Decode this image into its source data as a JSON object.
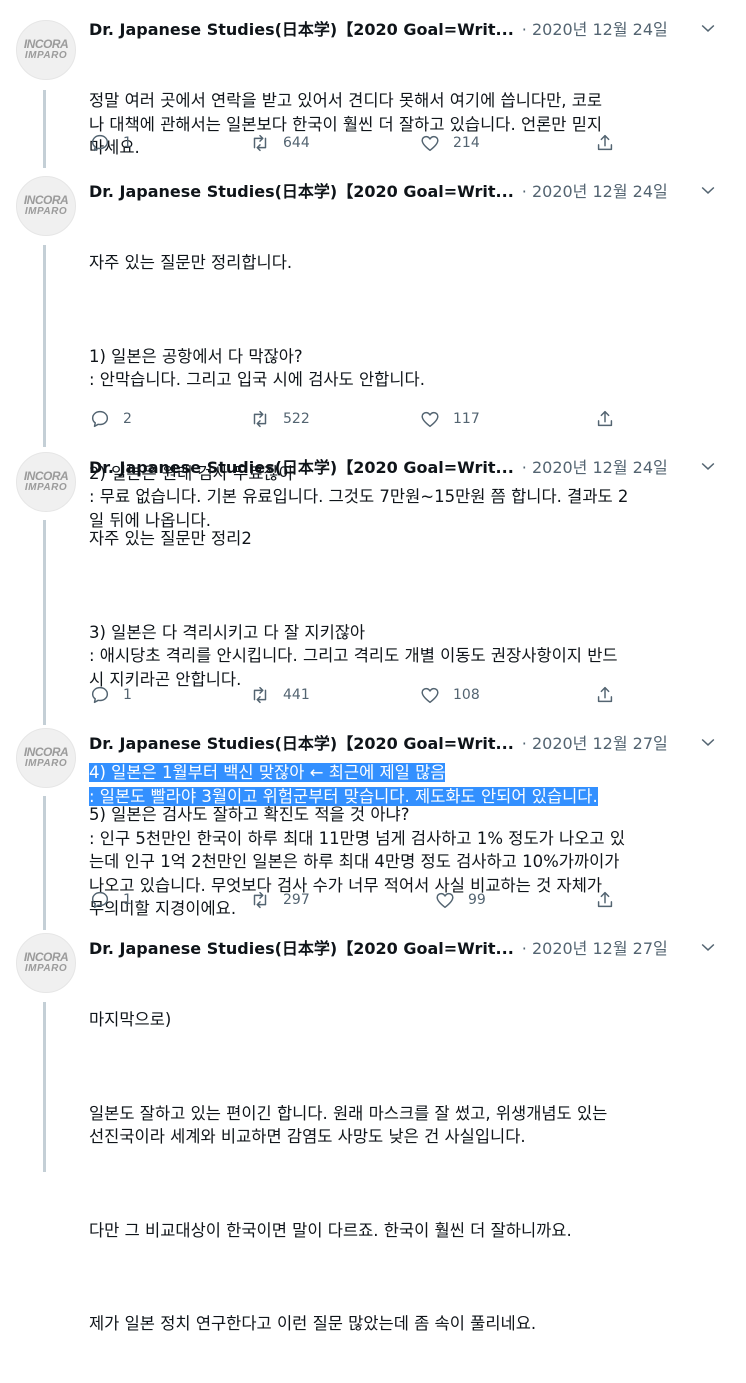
{
  "tweets": [
    {
      "avatar": {
        "line1": "INCORA",
        "line2": "IMPARO"
      },
      "author": "Dr. Japanese Studies(日本学)【2020 Goal=Writ...",
      "date": "· 2020년 12월 24일",
      "paragraphs": [
        "정말 여러 곳에서 연락을 받고 있어서 견디다 못해서 여기에 씁니다만, 코로\n나 대책에 관해서는 일본보다 한국이 훨씬 더 잘하고 있습니다. 언론만 믿지\n마세요."
      ],
      "replies": "1",
      "retweets": "644",
      "likes": "214"
    },
    {
      "avatar": {
        "line1": "INCORA",
        "line2": "IMPARO"
      },
      "author": "Dr. Japanese Studies(日本学)【2020 Goal=Writ...",
      "date": "· 2020년 12월 24일",
      "paragraphs": [
        "자주 있는 질문만 정리합니다.",
        "1) 일본은 공항에서 다 막잖아?\n: 안막습니다. 그리고 입국 시에 검사도 안합니다.",
        "2) 일본은 원래 검사 무료잖아\n: 무료 없습니다. 기본 유료입니다. 그것도 7만원~15만원 쯤 합니다. 결과도 2\n일 뒤에 나옵니다."
      ],
      "replies": "2",
      "retweets": "522",
      "likes": "117"
    },
    {
      "avatar": {
        "line1": "INCORA",
        "line2": "IMPARO"
      },
      "author": "Dr. Japanese Studies(日本学)【2020 Goal=Writ...",
      "date": "· 2020년 12월 24일",
      "paragraphs": [
        "자주 있는 질문만 정리2",
        "3) 일본은 다 격리시키고 다 잘 지키잖아\n: 애시당초 격리를 안시킵니다. 그리고 격리도 개별 이동도 권장사항이지 반드\n시 지키라곤 안합니다."
      ],
      "highlight_lines": [
        "4) 일본은 1월부터 백신 맞잖아 ← 최근에 제일 많음",
        ": 일본도 빨라야 3월이고 위험군부터 맞습니다. 제도화도 안되어 있습니다."
      ],
      "replies": "1",
      "retweets": "441",
      "likes": "108"
    },
    {
      "avatar": {
        "line1": "INCORA",
        "line2": "IMPARO"
      },
      "author": "Dr. Japanese Studies(日本学)【2020 Goal=Writ...",
      "date": "· 2020년 12월 27일",
      "paragraphs": [
        "5) 일본은 검사도 잘하고 확진도 적을 것 아냐?\n: 인구 5천만인 한국이 하루 최대 11만명 넘게 검사하고 1% 정도가 나오고 있\n는데 인구 1억 2천만인 일본은 하루 최대 4만명 정도 검사하고 10%가까이가\n나오고 있습니다. 무엇보다 검사 수가 너무 적어서 사실 비교하는 것 자체가\n무의미할 지경이에요."
      ],
      "replies": "1",
      "retweets": "297",
      "likes": "99"
    },
    {
      "avatar": {
        "line1": "INCORA",
        "line2": "IMPARO"
      },
      "author": "Dr. Japanese Studies(日本学)【2020 Goal=Writ...",
      "date": "· 2020년 12월 27일",
      "paragraphs": [
        "마지막으로)",
        "일본도 잘하고 있는 편이긴 합니다. 원래 마스크를 잘 썼고, 위생개념도 있는\n선진국이라 세계와 비교하면 감염도 사망도 낮은 건 사실입니다.",
        "다만 그 비교대상이 한국이면 말이 다르죠. 한국이 훨씬 더 잘하니까요.",
        "제가 일본 정치 연구한다고 이런 질문 많았는데 좀 속이 풀리네요."
      ]
    }
  ],
  "colors": {
    "highlight": "#3390ff",
    "secondary": "#536471",
    "thread_line": "#c4cfd6"
  },
  "icons": {
    "reply": "speech-bubble-icon",
    "retweet": "retweet-arrows-icon",
    "like": "heart-icon",
    "share": "share-upload-icon",
    "more": "chevron-down-icon"
  }
}
